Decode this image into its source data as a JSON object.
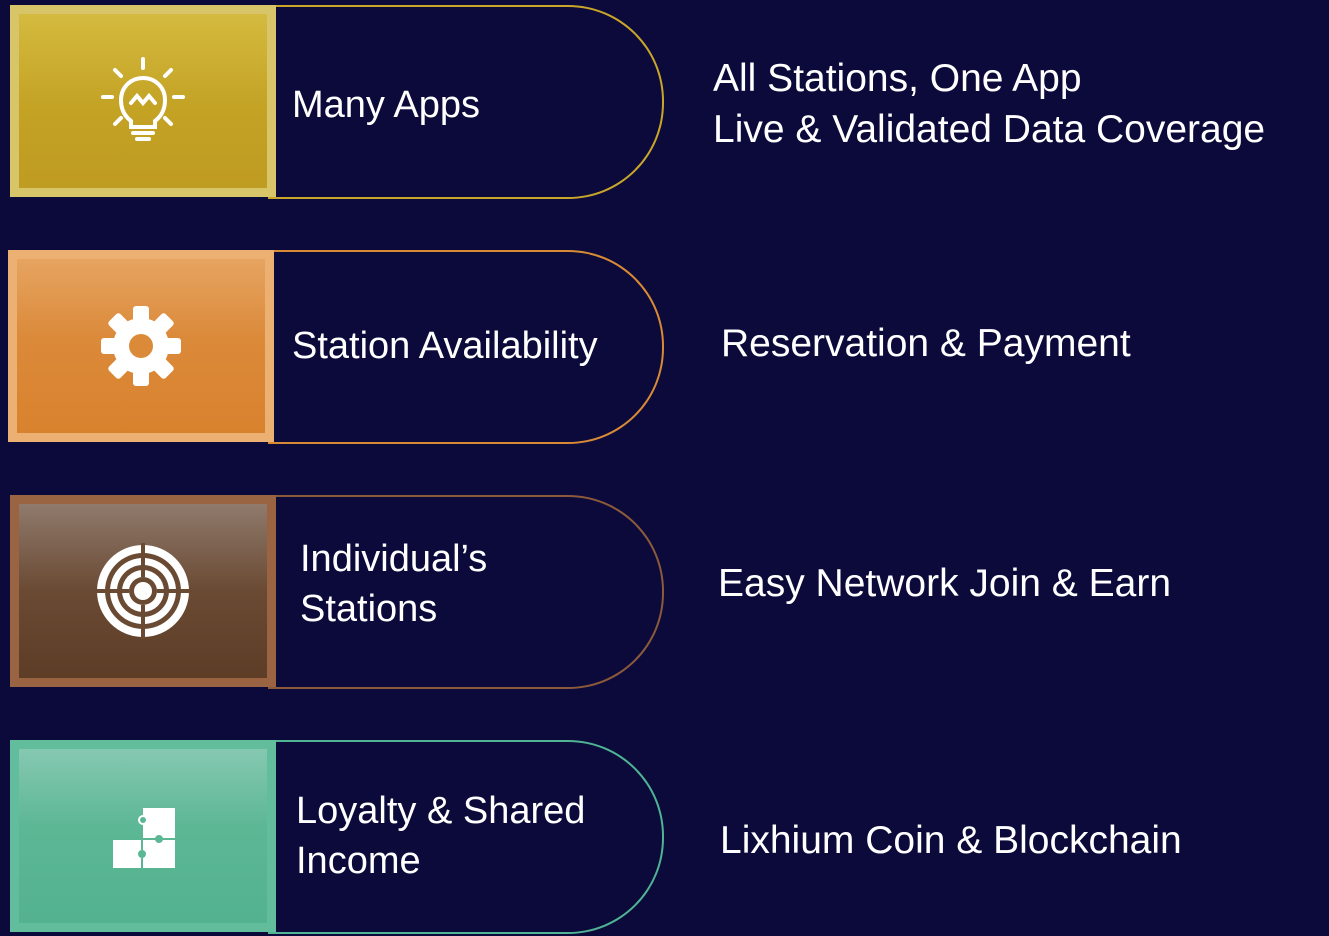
{
  "rows": [
    {
      "label": "Many Apps",
      "icon": "lightbulb-icon",
      "description_lines": [
        "All Stations, One App",
        "Live & Validated Data Coverage"
      ],
      "accent": "#c9a62a"
    },
    {
      "label": "Station Availability",
      "icon": "gear-icon",
      "description_lines": [
        "Reservation & Payment"
      ],
      "accent": "#d98a35"
    },
    {
      "label_lines": [
        "Individual’s",
        "Stations"
      ],
      "icon": "target-icon",
      "description_lines": [
        "Easy Network Join & Earn"
      ],
      "accent": "#8c5a3a"
    },
    {
      "label_lines": [
        "Loyalty & Shared",
        "Income"
      ],
      "icon": "puzzle-icon",
      "description_lines": [
        "Lixhium Coin & Blockchain"
      ],
      "accent": "#4fb394"
    }
  ],
  "background": "#0b0a3a"
}
